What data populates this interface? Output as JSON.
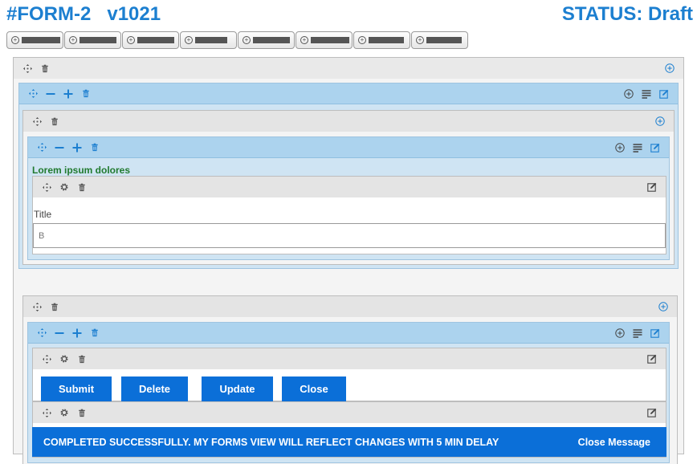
{
  "header": {
    "form_title": "#FORM-2   v1021",
    "status": "STATUS: Draft"
  },
  "palette": {
    "button_count": 8
  },
  "colors": {
    "accent": "#1c7fd0",
    "button_blue": "#0b6fd8",
    "panel_blue": "#acd3ee",
    "heading_green": "#217a2f"
  },
  "panel2": {
    "heading": "Lorem ipsum dolores"
  },
  "field1": {
    "label": "Title",
    "value": "B"
  },
  "buttons": {
    "submit": "Submit",
    "delete": "Delete",
    "update": "Update",
    "close": "Close"
  },
  "banner": {
    "message": "COMPLETED SUCCESSFULLY. MY FORMS VIEW WILL REFLECT CHANGES WITH 5 MIN DELAY",
    "close_label": "Close Message"
  }
}
